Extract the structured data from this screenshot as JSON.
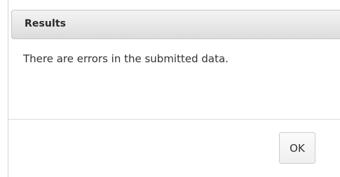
{
  "dialog": {
    "title": "Results",
    "message": "There are errors in the submitted data.",
    "ok_label": "OK"
  }
}
